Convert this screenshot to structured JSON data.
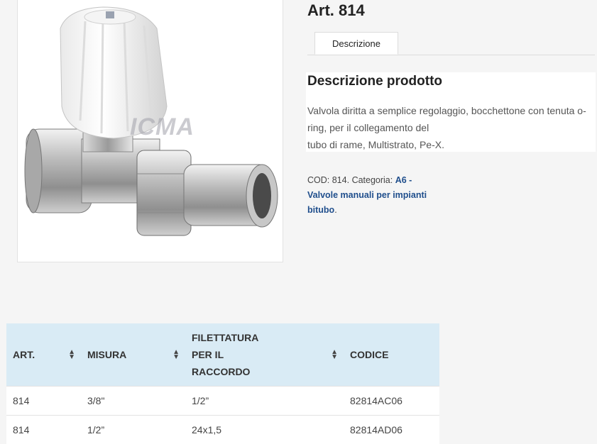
{
  "product": {
    "title": "Art. 814",
    "image_alt": "Valvola diritta ICMA",
    "logo_text": "ICMA"
  },
  "tabs": [
    {
      "label": "Descrizione"
    }
  ],
  "description": {
    "heading": "Descrizione prodotto",
    "lines": [
      "Valvola diritta a semplice regolaggio, bocchettone con tenuta o-",
      "ring, per il collegamento del",
      "tubo di rame, Multistrato, Pe-X."
    ]
  },
  "meta": {
    "cod_label": "COD:",
    "cod_value": "814.",
    "category_label": "Categoria:",
    "category_link": "A6 - Valvole manuali per impianti bitubo",
    "suffix": "."
  },
  "table": {
    "headers": [
      {
        "label": "ART.",
        "sortable": true
      },
      {
        "label": "MISURA",
        "sortable": true
      },
      {
        "label": "FILETTATURA PER IL RACCORDO",
        "sortable": true
      },
      {
        "label": "CODICE",
        "sortable": false
      }
    ],
    "rows": [
      [
        "814",
        "3/8\"",
        "1/2”",
        "82814AC06"
      ],
      [
        "814",
        "1/2”",
        "24x1,5",
        "82814AD06"
      ]
    ]
  },
  "icons": {
    "sort": "sort-updown-icon"
  }
}
